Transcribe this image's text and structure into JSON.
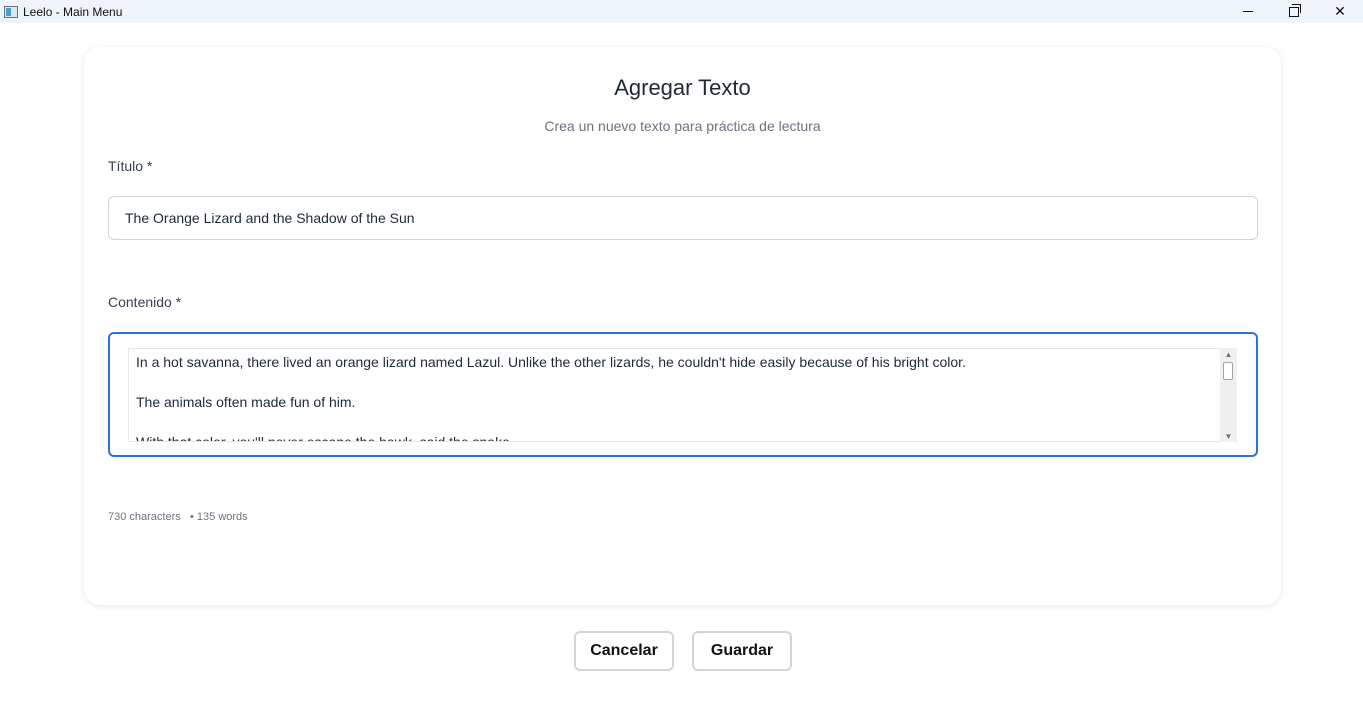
{
  "window": {
    "title": "Leelo - Main Menu",
    "controls": {
      "minimize": "minimize",
      "maximize": "maximize",
      "close": "✕"
    }
  },
  "form": {
    "heading": "Agregar Texto",
    "subheading": "Crea un nuevo texto para práctica de lectura",
    "title_label": "Título *",
    "title_value": "The Orange Lizard and the Shadow of the Sun",
    "content_label": "Contenido *",
    "content_lines": [
      "In a hot savanna, there lived an orange lizard named Lazul. Unlike the other lizards, he couldn't hide easily because of his bright color.",
      "The animals often made fun of him.",
      "With that color, you'll never escape the hawk, said the snake."
    ],
    "stats": {
      "characters": "730 characters",
      "words": "• 135 words"
    }
  },
  "actions": {
    "cancel_label": "Cancelar",
    "save_label": "Guardar"
  },
  "colors": {
    "focus_border": "#2f6fde",
    "titlebar_bg": "#eef4fa",
    "muted_text": "#6b7280"
  },
  "icons": {
    "app": "app-window-icon",
    "scroll_up": "chevron-up-icon",
    "scroll_down": "chevron-down-icon"
  }
}
